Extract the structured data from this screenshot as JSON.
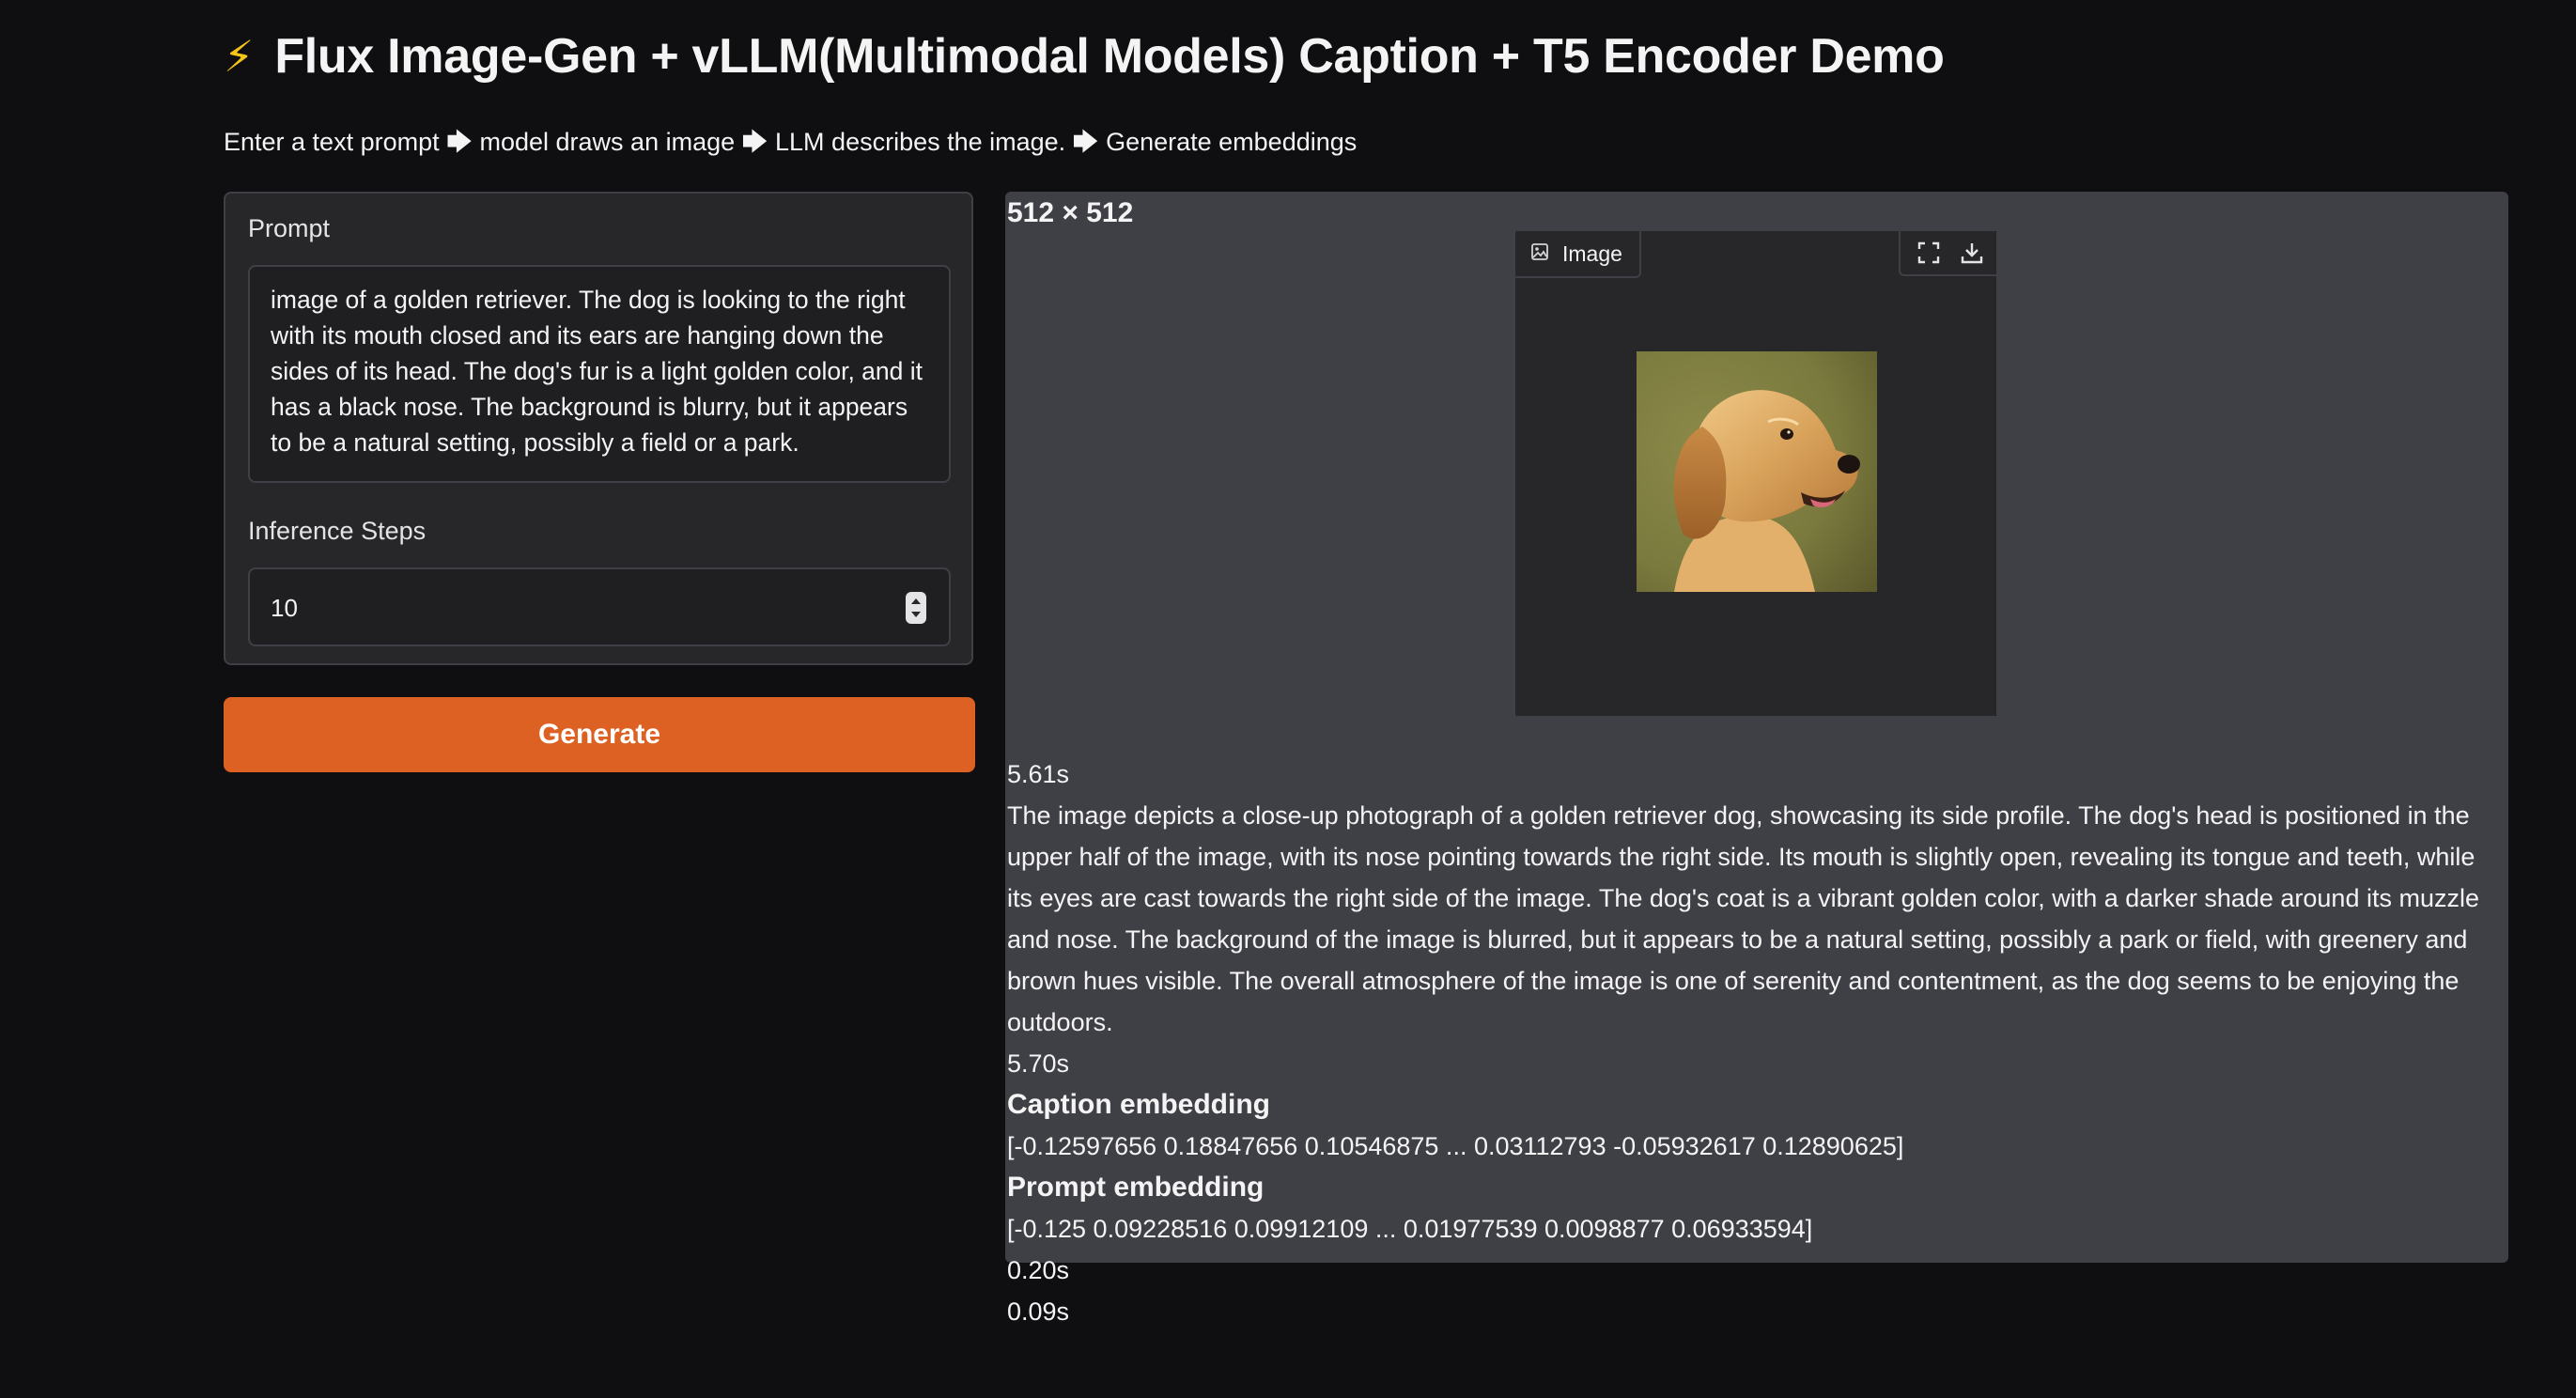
{
  "header": {
    "bolt_icon": "⚡",
    "title": "Flux Image-Gen + vLLM(Multimodal Models) Caption + T5 Encoder Demo",
    "subtitle": "Enter a text prompt 🡆 model draws an image 🡆 LLM describes the image. 🡆 Generate embeddings"
  },
  "inputs": {
    "prompt_label": "Prompt",
    "prompt_value": "image of a golden retriever. The dog is looking to the right with its mouth closed and its ears are hanging down the sides of its head. The dog's fur is a light golden color, and it has a black nose. The background is blurry, but it appears to be a natural setting, possibly a field or a park.",
    "steps_label": "Inference Steps",
    "steps_value": "10"
  },
  "actions": {
    "generate_label": "Generate"
  },
  "output": {
    "resolution": "512 × 512",
    "image_label": "Image",
    "image_time": "5.61s",
    "caption": "The image depicts a close-up photograph of a golden retriever dog, showcasing its side profile. The dog's head is positioned in the upper half of the image, with its nose pointing towards the right side. Its mouth is slightly open, revealing its tongue and teeth, while its eyes are cast towards the right side of the image. The dog's coat is a vibrant golden color, with a darker shade around its muzzle and nose. The background of the image is blurred, but it appears to be a natural setting, possibly a park or field, with greenery and brown hues visible. The overall atmosphere of the image is one of serenity and contentment, as the dog seems to be enjoying the outdoors.",
    "caption_time": "5.70s",
    "caption_embedding_heading": "Caption embedding",
    "caption_embedding": "[-0.12597656 0.18847656 0.10546875 ... 0.03112793 -0.05932617 0.12890625]",
    "prompt_embedding_heading": "Prompt embedding",
    "prompt_embedding": "[-0.125 0.09228516 0.09912109 ... 0.01977539 0.0098877 0.06933594]",
    "embedding_time_1": "0.20s",
    "embedding_time_2": "0.09s"
  },
  "icons": {
    "image_icon": "image-icon",
    "fullscreen_icon": "fullscreen-icon",
    "download_icon": "download-icon",
    "spinner_icon": "number-spinner-icon"
  },
  "colors": {
    "background": "#0f0f11",
    "panel": "#27272a",
    "output_panel": "#3f3f46",
    "accent": "#dd6122"
  }
}
